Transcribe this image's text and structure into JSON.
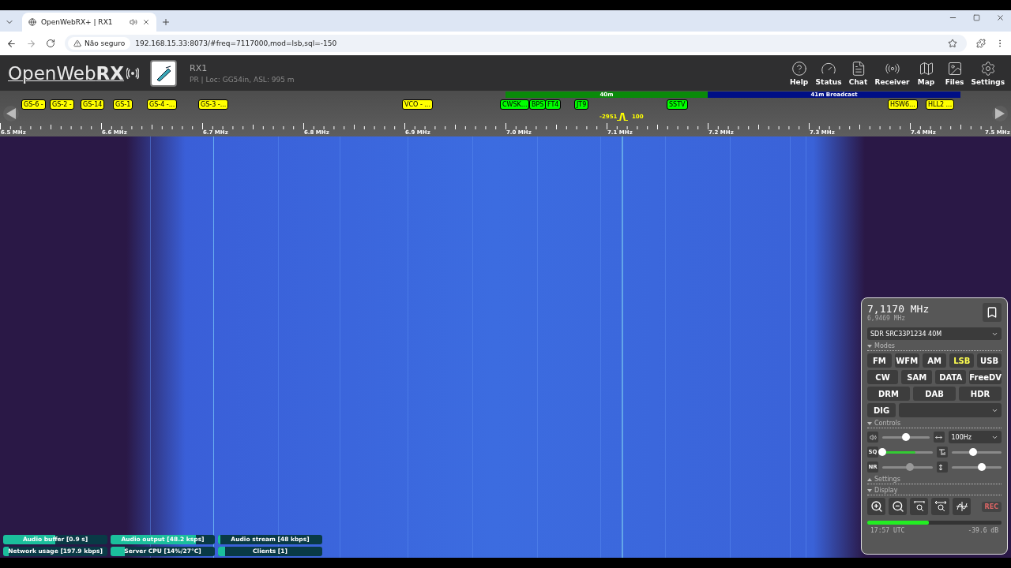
{
  "browser": {
    "tab": {
      "title": "OpenWebRX+ | RX1",
      "selected": true
    },
    "security": "Não seguro",
    "url": "192.168.15.33:8073/#freq=7117000,mod=lsb,sql=-150"
  },
  "header": {
    "logo": "OpenWeb**RX**",
    "receiver_name": "RX1",
    "receiver_details": "PR | Loc: GG54in, ASL: 995 m",
    "nav": [
      "Help",
      "Status",
      "Chat",
      "Receiver",
      "Map",
      "Files",
      "Settings"
    ]
  },
  "bands": [
    {
      "label": "40m",
      "color": "#0a8a0a"
    },
    {
      "label": "41m Broadcast",
      "color": "#000f86"
    }
  ],
  "bookmarks": [
    {
      "label": "GS-6 -",
      "color": "#ffff00"
    },
    {
      "label": "GS-2 -",
      "color": "#ffff00"
    },
    {
      "label": "GS-14",
      "color": "#ffff00"
    },
    {
      "label": "GS-1",
      "color": "#ffff00"
    },
    {
      "label": "GS-4 -...",
      "color": "#ffff00"
    },
    {
      "label": "GS-3 -...",
      "color": "#ffff00"
    },
    {
      "label": "VCO - ...",
      "color": "#ffff00"
    },
    {
      "label": "CWSK...",
      "color": "#00ff00"
    },
    {
      "label": "BPS",
      "color": "#00ff00"
    },
    {
      "label": "FT4",
      "color": "#00ff00"
    },
    {
      "label": "JT9",
      "color": "#00ff00"
    },
    {
      "label": "SSTV",
      "color": "#00ff00"
    },
    {
      "label": "HSW6...",
      "color": "#ffff00"
    },
    {
      "label": "HLL2 ...",
      "color": "#ffff00"
    }
  ],
  "passband": {
    "low": "-2951",
    "high": "100"
  },
  "scale": [
    "6.5 MHz",
    "6.6 MHz",
    "6.7 MHz",
    "6.8 MHz",
    "6.9 MHz",
    "7.0 MHz",
    "7.1 MHz",
    "7.2 MHz",
    "7.3 MHz",
    "7.4 MHz",
    "7.5 MHz"
  ],
  "receiver_panel": {
    "frequency": "7,1170 MHz",
    "offset_frequency": "6,9469 MHz",
    "profile": "SDR SRC33P1234 40M",
    "sections": {
      "modes": {
        "title": "Modes",
        "expanded": true
      },
      "controls": {
        "title": "Controls",
        "expanded": true
      },
      "settings": {
        "title": "Settings",
        "expanded": false
      },
      "display": {
        "title": "Display",
        "expanded": true
      }
    },
    "mode_rows": [
      [
        {
          "label": "FM",
          "selected": false
        },
        {
          "label": "WFM",
          "selected": false
        },
        {
          "label": "AM",
          "selected": false
        },
        {
          "label": "LSB",
          "selected": true
        },
        {
          "label": "USB",
          "selected": false
        }
      ],
      [
        {
          "label": "CW",
          "selected": false
        },
        {
          "label": "SAM",
          "selected": false
        },
        {
          "label": "DATA",
          "selected": false
        },
        {
          "label": "FreeDV",
          "selected": false
        }
      ],
      [
        {
          "label": "DRM",
          "selected": false
        },
        {
          "label": "DAB",
          "selected": false
        },
        {
          "label": "HDR",
          "selected": false
        }
      ]
    ],
    "digital_mode": {
      "label": "DIG",
      "selected": false
    },
    "volume": {
      "level": 0.5
    },
    "bandwidth": "100Hz",
    "squelch": {
      "label": "SQ",
      "level": 0.0
    },
    "squelch_meter": {
      "level": 0.66
    },
    "tune": {
      "level": 0.44
    },
    "noise_reduction": {
      "label": "NR",
      "level": 0.55,
      "disabled": true
    },
    "agc": {
      "level": 0.6
    },
    "record": {
      "label": "REC",
      "on": false
    },
    "signal": {
      "level": 0.46
    },
    "time": "17:57 UTC",
    "signal_reading": "-39.6 dB"
  },
  "status_bars": [
    {
      "label": "Audio buffer [0.9 s]",
      "level": 0.5
    },
    {
      "label": "Audio output [48.2 ksps]",
      "level": 0.82
    },
    {
      "label": "Audio stream [48 kbps]",
      "level": 0.02
    },
    {
      "label": "Network usage [197.9 kbps]",
      "level": 0.05
    },
    {
      "label": "Server CPU [14%/27°C]",
      "level": 0.14
    },
    {
      "label": "Clients [1]",
      "level": 0.07
    }
  ]
}
